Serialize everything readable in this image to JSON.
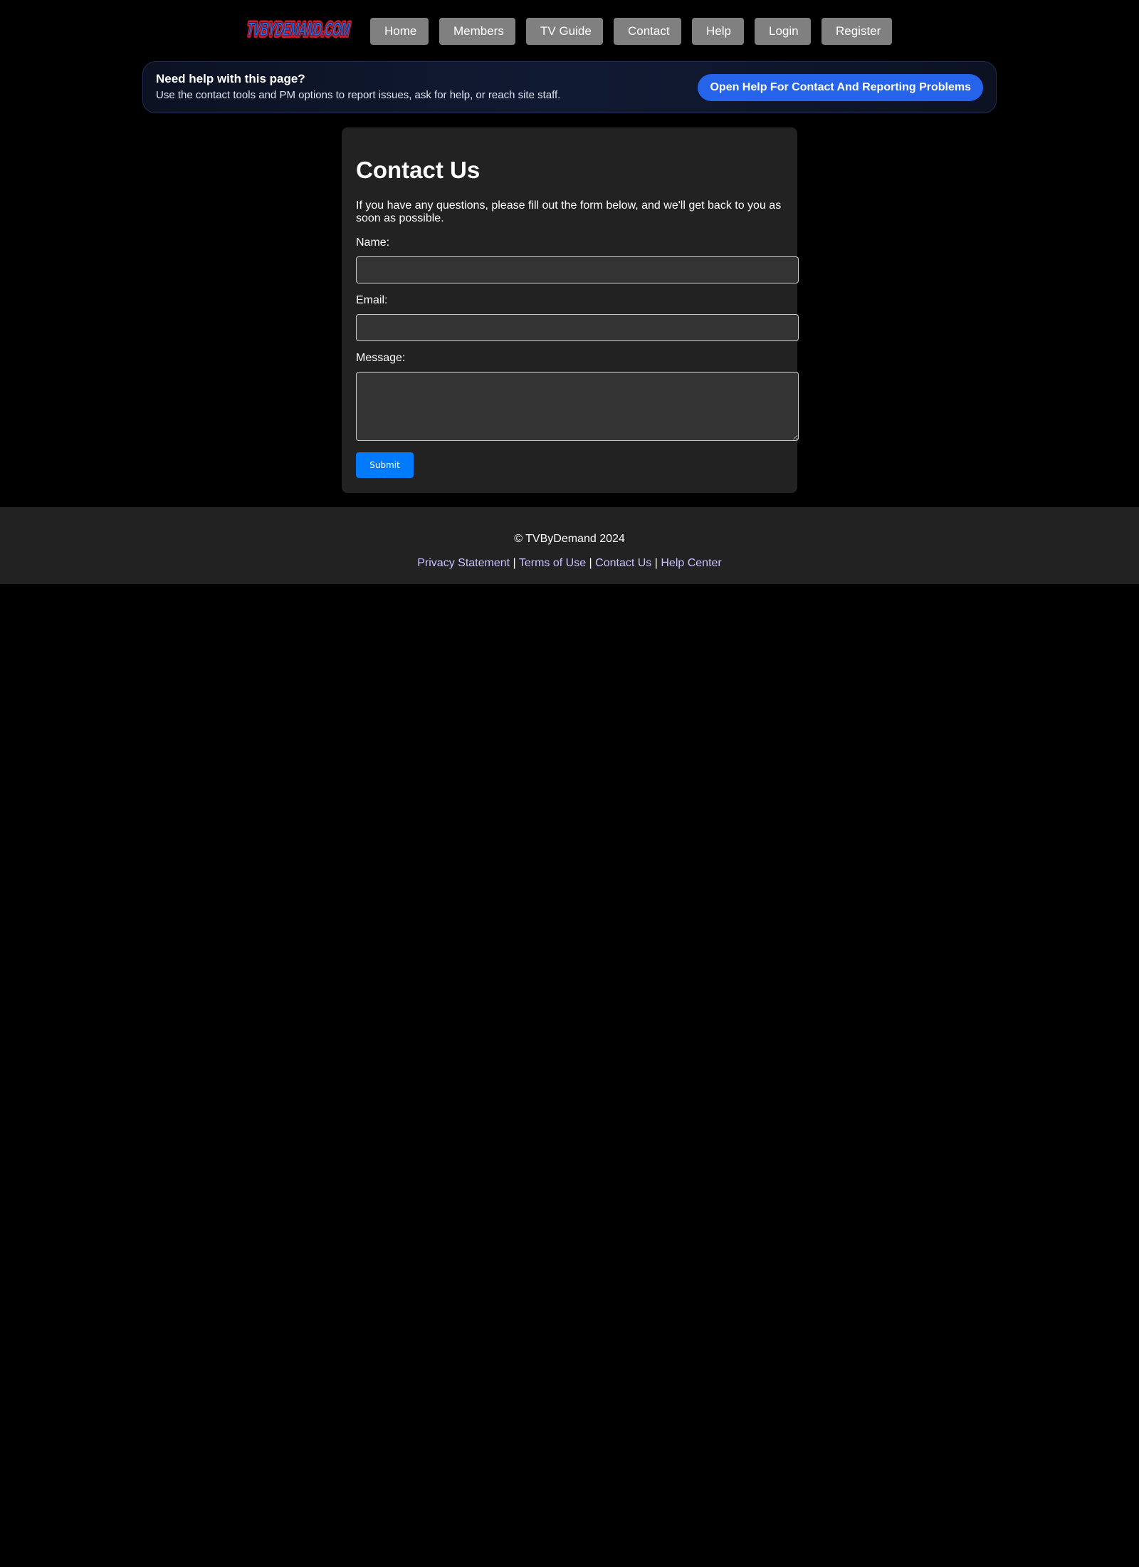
{
  "header": {
    "logo_text": "TVBYDEMAND.COM",
    "nav": [
      {
        "label": "Home"
      },
      {
        "label": "Members"
      },
      {
        "label": "TV Guide"
      },
      {
        "label": "Contact"
      },
      {
        "label": "Help"
      },
      {
        "label": "Login"
      },
      {
        "label": "Register"
      }
    ]
  },
  "help_banner": {
    "title": "Need help with this page?",
    "subtitle": "Use the contact tools and PM options to report issues, ask for help, or reach site staff.",
    "button_label": "Open Help For Contact And Reporting Problems"
  },
  "contact_form": {
    "title": "Contact Us",
    "intro": "If you have any questions, please fill out the form below, and we'll get back to you as soon as possible.",
    "name_label": "Name:",
    "name_value": "",
    "email_label": "Email:",
    "email_value": "",
    "message_label": "Message:",
    "message_value": "",
    "submit_label": "Submit"
  },
  "footer": {
    "copyright": "© TVByDemand 2024",
    "links": [
      {
        "label": "Privacy Statement"
      },
      {
        "label": "Terms of Use"
      },
      {
        "label": "Contact Us"
      },
      {
        "label": "Help Center"
      }
    ],
    "separator": "|"
  },
  "colors": {
    "page_background": "#000000",
    "nav_button": "#808080",
    "card_background": "#222222",
    "input_background": "#333333",
    "submit_button": "#007bff",
    "help_button": "#2563eb",
    "footer_link": "#c8c3ff"
  }
}
